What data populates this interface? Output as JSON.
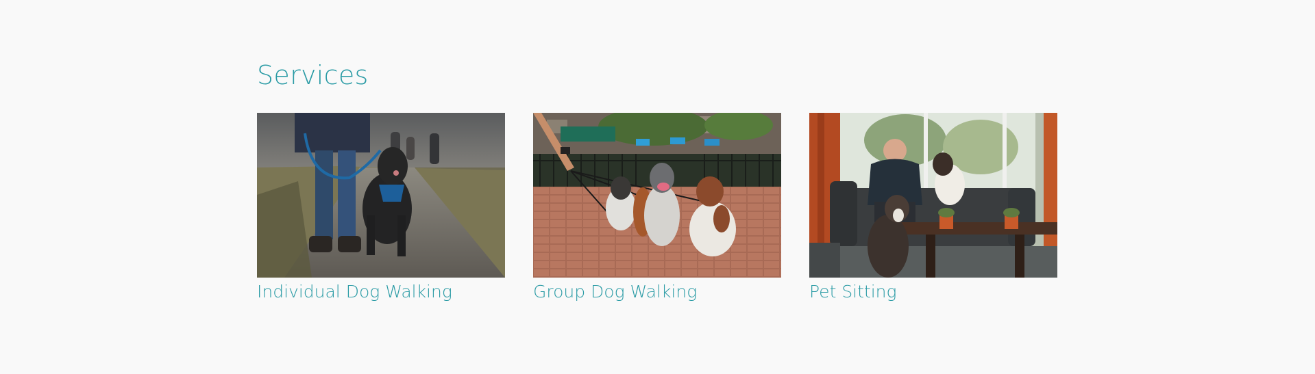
{
  "services": {
    "title": "Services",
    "cards": [
      {
        "label": "Individual Dog Walking",
        "image_alt": "Person walking a black dog on a leash along a path"
      },
      {
        "label": "Group Dog Walking",
        "image_alt": "Group of dogs on leashes sitting on a brick plaza"
      },
      {
        "label": "Pet Sitting",
        "image_alt": "Man sitting on a sofa with two dogs in a living room"
      }
    ]
  },
  "colors": {
    "accent": "#2a9ba5",
    "background": "#f9f9f9"
  }
}
